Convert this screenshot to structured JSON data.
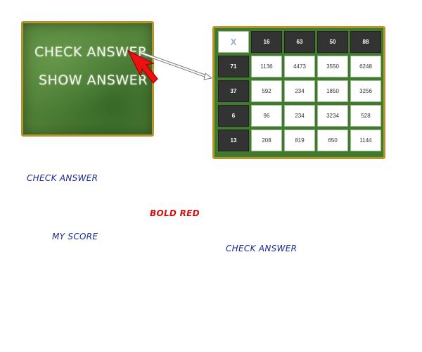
{
  "board": {
    "check_label": "CHECK ANSWER",
    "show_label": "SHOW ANSWER"
  },
  "grid": {
    "corner": "X",
    "columns": [
      "16",
      "63",
      "50",
      "88"
    ],
    "rows": [
      {
        "header": "71",
        "cells": [
          "1136",
          "4473",
          "3550",
          "6248"
        ]
      },
      {
        "header": "37",
        "cells": [
          "592",
          "234",
          "1850",
          "3256"
        ]
      },
      {
        "header": "6",
        "cells": [
          "96",
          "234",
          "3234",
          "528"
        ]
      },
      {
        "header": "13",
        "cells": [
          "208",
          "819",
          "650",
          "1144"
        ]
      }
    ]
  },
  "labels": {
    "check_answer_1": "CHECK ANSWER",
    "bold_red": "BOLD RED",
    "my_score": "MY SCORE",
    "check_answer_2": "CHECK ANSWER"
  },
  "colors": {
    "board_green": "#4f7f36",
    "frame_gold": "#b7952a",
    "header_dark": "#333333",
    "label_blue": "#1a2aa0",
    "label_red": "#d01010"
  }
}
